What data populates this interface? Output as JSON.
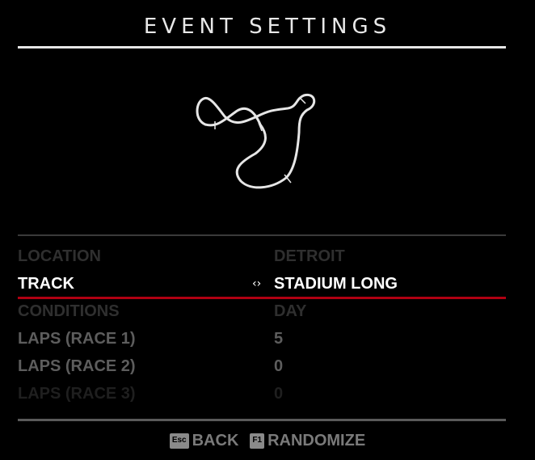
{
  "header": {
    "title": "EVENT SETTINGS"
  },
  "settings": [
    {
      "label": "LOCATION",
      "value": "DETROIT",
      "state": "dim1"
    },
    {
      "label": "TRACK",
      "value": "STADIUM LONG",
      "state": "selected"
    },
    {
      "label": "CONDITIONS",
      "value": "DAY",
      "state": "dim1"
    },
    {
      "label": "LAPS (RACE 1)",
      "value": "5",
      "state": "dim2"
    },
    {
      "label": "LAPS (RACE 2)",
      "value": "0",
      "state": "dim2"
    },
    {
      "label": "LAPS (RACE 3)",
      "value": "0",
      "state": "dim3"
    }
  ],
  "selector_icon": "left-right-arrows-icon",
  "footer": {
    "back": {
      "key": "Esc",
      "label": "BACK"
    },
    "randomize": {
      "key": "F1",
      "label": "RANDOMIZE"
    }
  },
  "colors": {
    "accent": "#b00012",
    "background": "#000000",
    "text_selected": "#ffffff",
    "text_disabled": "#2f2f2f"
  }
}
